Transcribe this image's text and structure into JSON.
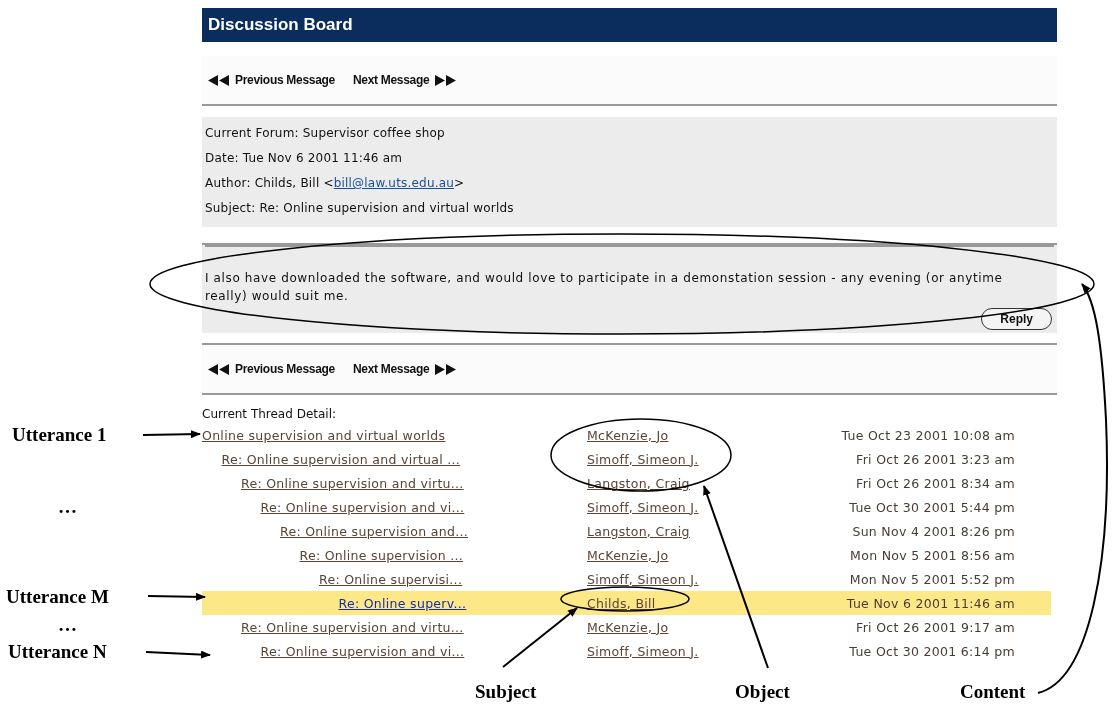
{
  "header": {
    "title": "Discussion Board"
  },
  "nav_top": {
    "previous": "Previous Message",
    "next": "Next Message"
  },
  "message": {
    "fields": [
      {
        "label": "Current Forum:",
        "value": "Supervisor coffee shop"
      },
      {
        "label": "Date:",
        "value": "Tue Nov 6 2001 11:46 am"
      },
      {
        "label": "Author:",
        "value": "Childs, Bill <",
        "link": "bill@law.uts.edu.au",
        "after": ">"
      },
      {
        "label": "Subject:",
        "value": "Re: Online supervision and virtual worlds"
      }
    ],
    "body": "I also have downloaded the software, and would love to participate in a demonstation session - any evening (or anytime really) would suit me.",
    "reply_button": "Reply"
  },
  "nav_bottom": {
    "previous": "Previous Message",
    "next": "Next Message"
  },
  "thread": {
    "label": "Current Thread Detail:",
    "rows": [
      {
        "subject": "Online supervision and virtual worlds",
        "author": "McKenzie, Jo",
        "date": "Tue Oct 23 2001 10:08 am",
        "selected": false,
        "children": [
          {
            "subject": "Re: Online supervision and virtual ...",
            "author": "Simoff, Simeon J.",
            "date": "Fri Oct 26 2001 3:23 am",
            "selected": false,
            "children": [
              {
                "subject": "Re: Online supervision and virtu...",
                "author": "Langston, Craig",
                "date": "Fri Oct 26 2001 8:34 am",
                "selected": false,
                "children": [
                  {
                    "subject": "Re: Online supervision and vi...",
                    "author": "Simoff, Simeon J.",
                    "date": "Tue Oct 30 2001 5:44 pm",
                    "selected": false,
                    "children": [
                      {
                        "subject": "Re: Online supervision and...",
                        "author": "Langston, Craig",
                        "date": "Sun Nov 4 2001 8:26 pm",
                        "selected": false,
                        "children": [
                          {
                            "subject": "Re: Online supervision ...",
                            "author": "McKenzie, Jo",
                            "date": "Mon Nov 5 2001 8:56 am",
                            "selected": false,
                            "children": [
                              {
                                "subject": "Re: Online supervisi...",
                                "author": "Simoff, Simeon J.",
                                "date": "Mon Nov 5 2001 5:52 pm",
                                "selected": false,
                                "children": [
                                  {
                                    "subject": "Re: Online superv...",
                                    "author": "Childs, Bill",
                                    "date": "Tue Nov 6 2001 11:46 am",
                                    "selected": true
                                  }
                                ]
                              }
                            ]
                          }
                        ]
                      }
                    ]
                  }
                ]
              },
              {
                "subject": "Re: Online supervision and virtu...",
                "author": "McKenzie, Jo",
                "date": "Fri Oct 26 2001 9:17 am",
                "selected": false,
                "children": [
                  {
                    "subject": "Re: Online supervision and vi...",
                    "author": "Simoff, Simeon J.",
                    "date": "Tue Oct 30 2001 6:14 pm",
                    "selected": false
                  }
                ]
              }
            ]
          }
        ]
      }
    ]
  },
  "annotations": {
    "left_labels": [
      "Utterance 1",
      "…",
      "Utterance M",
      "…",
      "Utterance N"
    ],
    "bottom_labels": [
      "Subject",
      "Object",
      "Content"
    ]
  }
}
